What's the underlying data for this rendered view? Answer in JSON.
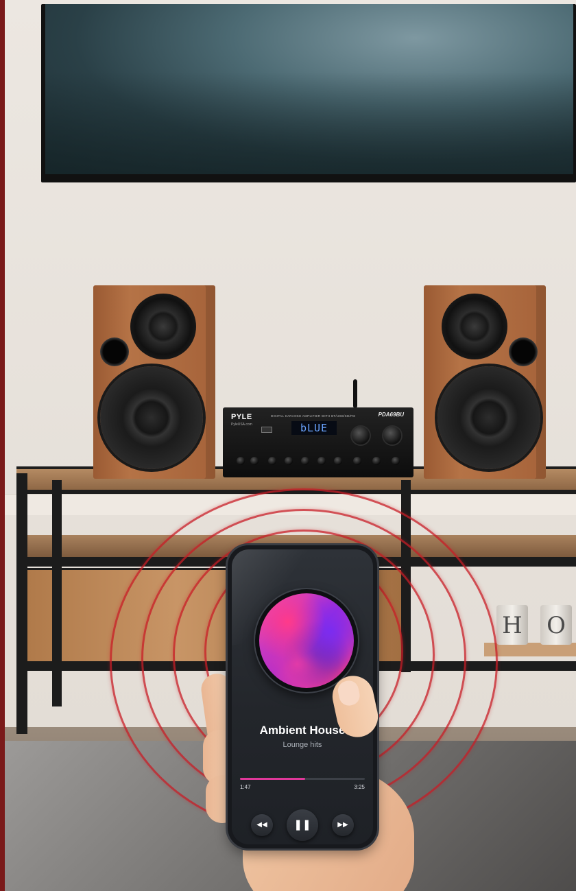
{
  "amplifier": {
    "brand": "PYLE",
    "brand_sub": "PyleUSA.com",
    "model": "PDA69BU",
    "title": "DIGITAL KARAOKE AMPLIFIER WITH BT/USB/SD/FM",
    "display": "bLUE"
  },
  "decor": {
    "cup_letters": [
      "H",
      "O"
    ]
  },
  "player": {
    "track_title": "Ambient House",
    "track_subtitle": "Lounge hits",
    "elapsed": "1:47",
    "total": "3:25",
    "progress_fraction": 0.52,
    "accent_color": "#e0389a",
    "controls": {
      "prev_icon": "rewind-icon",
      "play_icon": "pause-icon",
      "next_icon": "fast-forward-icon",
      "prev_glyph": "◀◀",
      "play_glyph": "❚❚",
      "next_glyph": "▶▶"
    }
  },
  "signal_color": "#c81c26"
}
